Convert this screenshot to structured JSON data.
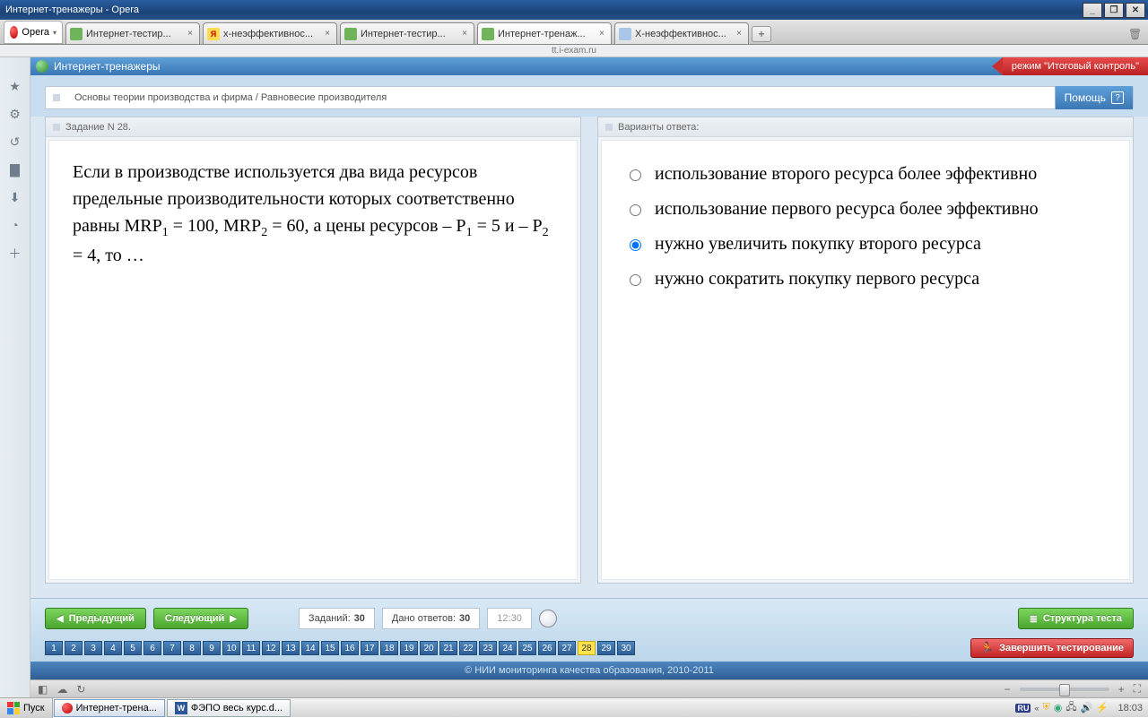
{
  "window": {
    "title": "Интернет-тренажеры - Opera"
  },
  "browser": {
    "menu_label": "Opera",
    "address": "tt.i-exam.ru",
    "tabs": [
      {
        "label": "Интернет-тестир...",
        "fav": "green"
      },
      {
        "label": "х-неэффективнос...",
        "fav": "y"
      },
      {
        "label": "Интернет-тестир...",
        "fav": "green"
      },
      {
        "label": "Интернет-тренаж...",
        "fav": "green",
        "active": true
      },
      {
        "label": "Х-неэффективнос...",
        "fav": "doc"
      }
    ]
  },
  "page": {
    "title": "Интернет-тренажеры",
    "mode": "режим \"Итоговый контроль\"",
    "breadcrumb": "Основы теории производства и фирма / Равновесие производителя",
    "help": "Помощь",
    "task_header": "Задание N 28.",
    "answers_header": "Варианты ответа:",
    "question_html": "Если в производстве используется два вида ресурсов предельные производительности которых соответственно равны MRP<sub>1</sub> = 100, MRP<sub>2</sub> = 60, а цены ресурсов – P<sub>1</sub> = 5 и – P<sub>2</sub> = 4, то …",
    "answers": [
      "использование второго ресурса более эффективно",
      "использование первого ресурса более эффективно",
      "нужно увеличить покупку второго ресурса",
      "нужно сократить покупку первого ресурса"
    ],
    "selected_answer": 2
  },
  "nav": {
    "prev": "Предыдущий",
    "next": "Следующий",
    "tasks_label": "Заданий:",
    "tasks_total": "30",
    "answered_label": "Дано ответов:",
    "answered_val": "30",
    "timer": "12:30",
    "struct_btn": "Структура теста",
    "finish_btn": "Завершить тестирование",
    "total_qs": 30,
    "current_q": 28
  },
  "footer": "© НИИ мониторинга качества образования, 2010-2011",
  "taskbar": {
    "start": "Пуск",
    "items": [
      {
        "label": "Интернет-трена...",
        "type": "opera",
        "active": true
      },
      {
        "label": "ФЭПО весь курс.d...",
        "type": "word"
      }
    ],
    "lang": "RU",
    "time": "18:03"
  }
}
